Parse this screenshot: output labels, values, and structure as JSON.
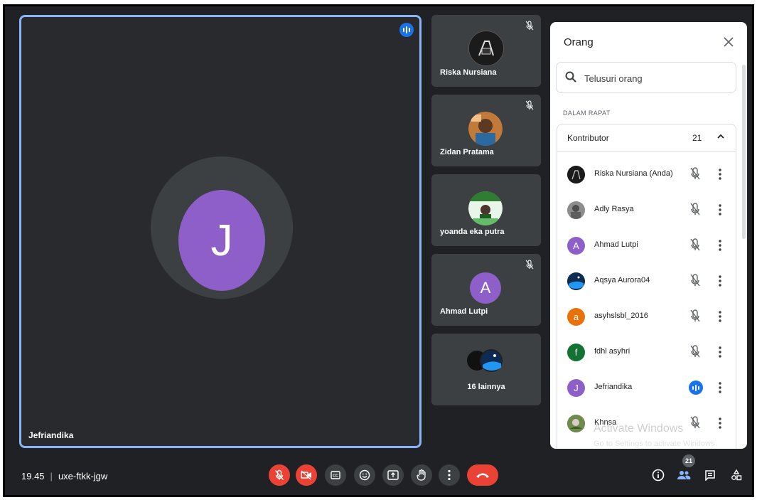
{
  "main_tile": {
    "initial": "J",
    "name": "Jefriandika",
    "avatar_color": "#8e5fc9",
    "speaking": true
  },
  "side_tiles": [
    {
      "name": "Riska Nursiana",
      "muted": true
    },
    {
      "name": "Zidan Pratama",
      "muted": true
    },
    {
      "name": "yoanda eka putra",
      "muted": false
    },
    {
      "name": "Ahmad Lutpi",
      "initial": "A",
      "muted": true,
      "avatar_color": "#8e5fc9"
    }
  ],
  "more_tile": {
    "label": "16 lainnya"
  },
  "panel": {
    "title": "Orang",
    "search_placeholder": "Telusuri orang",
    "section_label": "DALAM RAPAT",
    "group_label": "Kontributor",
    "group_count": "21",
    "participants": [
      {
        "name": "Riska Nursiana (Anda)",
        "status": "muted",
        "avatar": "photo-dark"
      },
      {
        "name": "Adly Rasya",
        "status": "muted",
        "avatar": "photo-gray"
      },
      {
        "name": "Ahmad Lutpi",
        "status": "muted",
        "initial": "A",
        "color": "#8e5fc9"
      },
      {
        "name": "Aqsya Aurora04",
        "status": "muted",
        "avatar": "photo-space"
      },
      {
        "name": "asyhslsbl_2016",
        "status": "muted",
        "initial": "a",
        "color": "#e8710a"
      },
      {
        "name": "fdhl asyhri",
        "status": "muted",
        "initial": "f",
        "color": "#137333"
      },
      {
        "name": "Jefriandika",
        "status": "speaking",
        "initial": "J",
        "color": "#8e5fc9"
      },
      {
        "name": "Khnsa",
        "status": "muted",
        "avatar": "photo-green"
      }
    ]
  },
  "watermark": {
    "line1": "Activate Windows",
    "line2": "Go to Settings to activate Windows."
  },
  "bottom_bar": {
    "time": "19.45",
    "meeting_code": "uxe-ftkk-jgw",
    "people_count": "21"
  },
  "colors": {
    "accent": "#8ab4f8",
    "danger": "#ea4335",
    "speaking": "#1a73e8"
  }
}
